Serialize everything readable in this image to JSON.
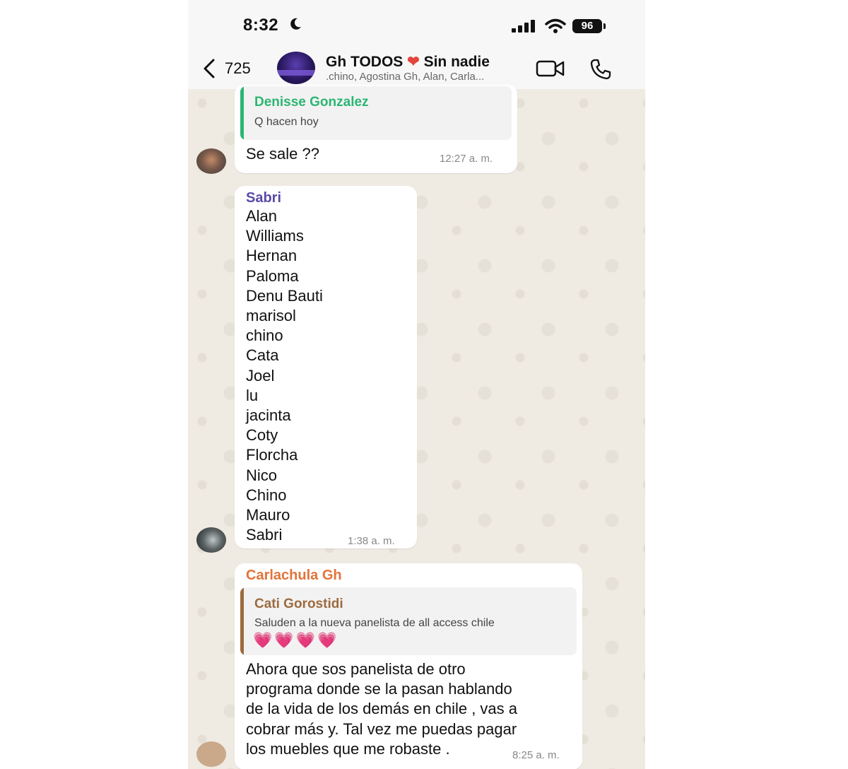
{
  "status_bar": {
    "time": "8:32",
    "battery": "96"
  },
  "header": {
    "back_count": "725",
    "title_left": "Gh TODOS",
    "title_heart": "❤",
    "title_right": "Sin nadie",
    "subtitle": ".chino, Agostina Gh, Alan, Carla..."
  },
  "colors": {
    "accent_green": "#2bb673",
    "sabri_purple": "#5b49a6",
    "carla_orange": "#e2743a",
    "cati_brown": "#9c6b3f"
  },
  "messages": [
    {
      "quote": {
        "name": "Denisse Gonzalez",
        "text": "Q hacen hoy"
      },
      "text": "Se sale ??",
      "time": "12:27 a. m."
    },
    {
      "sender": "Sabri",
      "text": "Alan\nWilliams\nHernan\nPaloma\nDenu Bauti\nmarisol\nchino\nCata\nJoel\nlu\njacinta\nCoty\nFlorcha\nNico\nChino\nMauro\nSabri",
      "time": "1:38 a. m."
    },
    {
      "sender": "Carlachula Gh",
      "quote": {
        "name": "Cati Gorostidi",
        "text": "Saluden a la nueva panelista de all access chile",
        "emoji": "💗💗💗💗"
      },
      "text": "Ahora que sos panelista de otro\nprograma donde se la pasan hablando\nde la vida de los demás en chile , vas a\ncobrar más y. Tal vez me puedas pagar\nlos muebles que me robaste .",
      "time": "8:25 a. m."
    }
  ],
  "icons": {
    "moon": "moon-icon",
    "signal": "signal-icon",
    "wifi": "wifi-icon",
    "back": "chevron-left-icon",
    "video": "video-camera-icon",
    "call": "phone-icon"
  }
}
